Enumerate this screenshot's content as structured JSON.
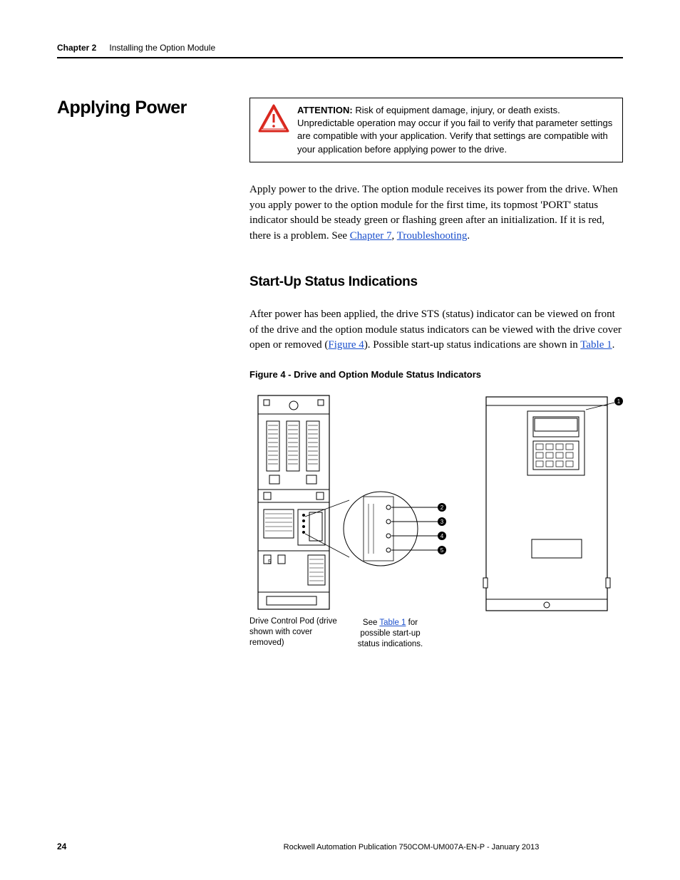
{
  "header": {
    "chapter": "Chapter 2",
    "title": "Installing the Option Module"
  },
  "section_heading": "Applying Power",
  "attention": {
    "label": "ATTENTION:",
    "body": " Risk of equipment damage, injury, or death exists. Unpredictable operation may occur if you fail to verify that parameter settings are compatible with your application. Verify that settings are compatible with your application before applying power to the drive."
  },
  "para1_pre": "Apply power to the drive. The option module receives its power from the drive. When you apply power to the option module for the first time, its topmost 'PORT' status indicator should be steady green or flashing green after an initialization. If it is red, there is a problem. See ",
  "link_chapter7": "Chapter 7",
  "para1_mid": ", ",
  "link_troubleshooting": "Troubleshooting",
  "para1_post": ".",
  "subsection_heading": "Start-Up Status Indications",
  "para2_pre": "After power has been applied, the drive STS (status) indicator can be viewed on front of the drive and the option module status indicators can be viewed with the drive cover open or removed (",
  "link_fig4": "Figure 4",
  "para2_mid": "). Possible start-up status indications are shown in ",
  "link_table1": "Table 1",
  "para2_post": ".",
  "figure_caption": "Figure 4 - Drive and Option Module Status Indicators",
  "figure_note_pre": "See ",
  "figure_note_link": "Table 1",
  "figure_note_post": " for possible start-up status indications.",
  "caption_under": "Drive Control Pod (drive shown with cover removed)",
  "footer": {
    "page": "24",
    "pub": "Rockwell Automation Publication 750COM-UM007A-EN-P - January 2013"
  },
  "callouts": [
    "1",
    "2",
    "3",
    "4",
    "5"
  ]
}
